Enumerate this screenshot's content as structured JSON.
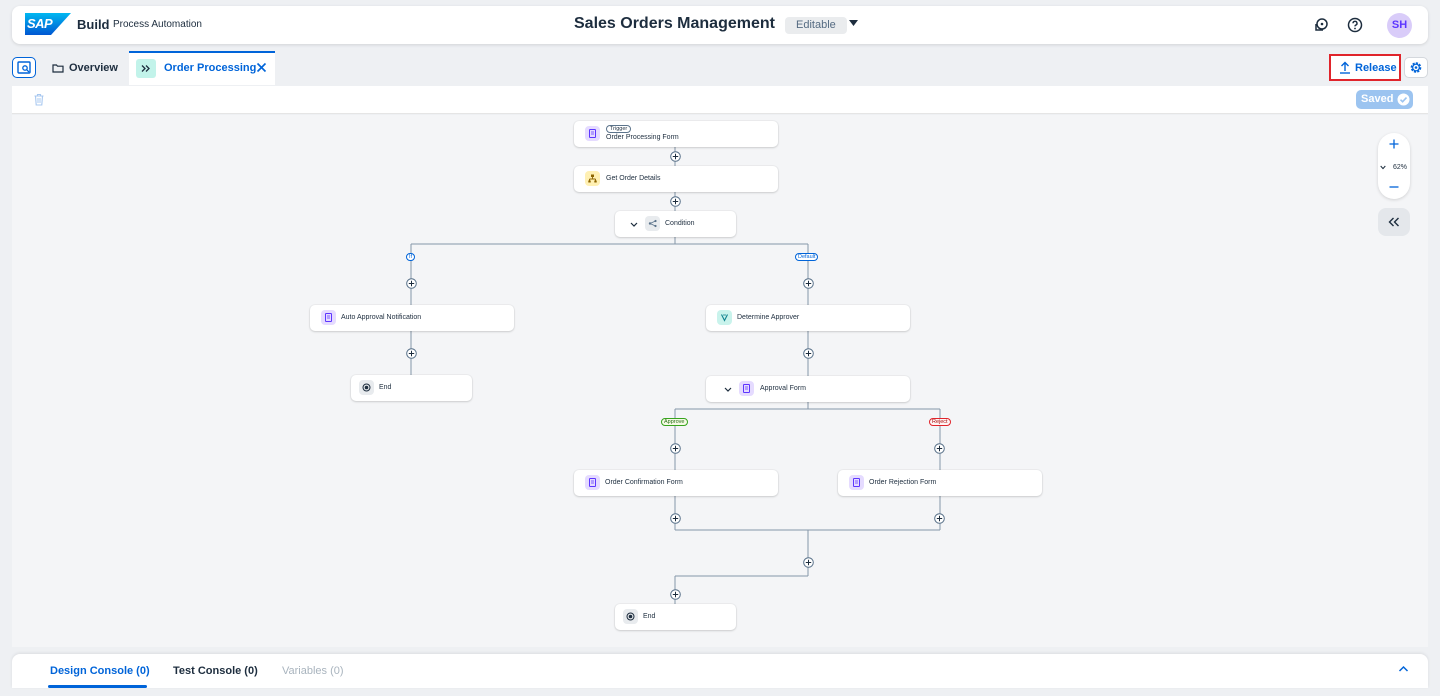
{
  "shell": {
    "logo_text": "SAP",
    "product": "Build",
    "subproduct": "Process Automation",
    "title": "Sales Orders Management",
    "status": "Editable",
    "user_initials": "SH"
  },
  "tabs": {
    "overview": "Overview",
    "current": "Order Processing"
  },
  "actions": {
    "release": "Release",
    "saved": "Saved"
  },
  "zoom": {
    "level": "62%"
  },
  "flow": {
    "trigger_tag": "Trigger",
    "trigger_form": "Order Processing Form",
    "get_details": "Get Order Details",
    "condition": "Condition",
    "branch_if": "If",
    "branch_default": "Default",
    "auto_approval": "Auto Approval Notification",
    "end_left": "End",
    "determine_approver": "Determine Approver",
    "approval_form": "Approval Form",
    "branch_approve": "Approve",
    "branch_reject": "Reject",
    "confirmation_form": "Order Confirmation Form",
    "rejection_form": "Order Rejection Form",
    "end_final": "End"
  },
  "console": {
    "design": "Design Console (0)",
    "test": "Test Console (0)",
    "variables": "Variables (0)"
  }
}
